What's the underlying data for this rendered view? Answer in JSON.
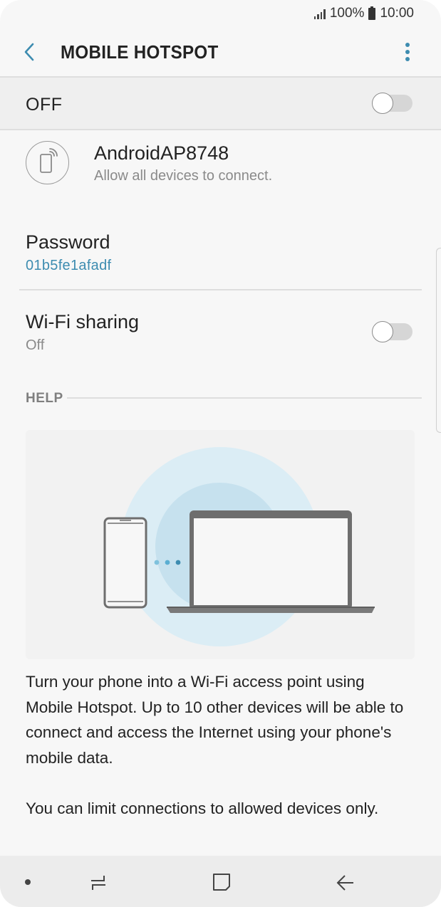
{
  "status_bar": {
    "battery_text": "100%",
    "time": "10:00"
  },
  "header": {
    "title": "MOBILE HOTSPOT",
    "back_icon": "chevron-left-icon",
    "more_icon": "more-vertical-icon"
  },
  "master_switch": {
    "label": "OFF",
    "state": false
  },
  "network": {
    "name": "AndroidAP8748",
    "subtitle": "Allow all devices to connect.",
    "icon": "phone-hotspot-icon"
  },
  "password": {
    "label": "Password",
    "value": "01b5fe1afadf"
  },
  "wifi_sharing": {
    "label": "Wi-Fi sharing",
    "status": "Off",
    "state": false
  },
  "help": {
    "label": "HELP",
    "illustration": "phone-to-laptop-hotspot-illustration",
    "paragraph1": "Turn your phone into a Wi-Fi access point using Mobile Hotspot. Up to 10 other devices will be able to connect and access the Internet using your phone's mobile data.",
    "paragraph2": "You can limit connections to allowed devices only."
  },
  "nav_bar": {
    "icons": [
      "dot-icon",
      "recent-apps-icon",
      "home-icon",
      "back-arrow-icon"
    ]
  },
  "colors": {
    "accent": "#3d8cb0",
    "background": "#f7f7f7",
    "switch_off_track": "#d6d6d6",
    "illustration_circle_outer": "#d9ebf4",
    "illustration_circle_inner": "#c2deec"
  }
}
